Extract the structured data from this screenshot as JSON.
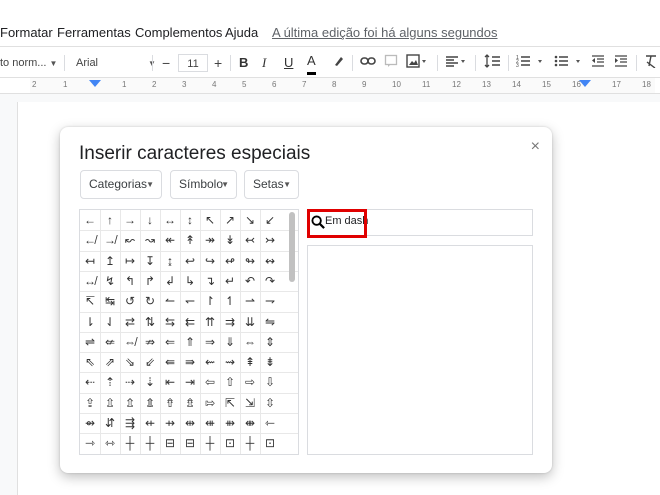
{
  "menu": {
    "items": [
      "Formatar",
      "Ferramentas",
      "Complementos",
      "Ajuda"
    ],
    "last_edit": "A última edição foi há alguns segundos"
  },
  "toolbar": {
    "style": "to norm...",
    "font": "Arial",
    "minus": "−",
    "font_size": "11",
    "plus": "+",
    "bold": "B",
    "italic": "I",
    "underline": "U",
    "text_color": "A"
  },
  "ruler": {
    "numbers": [
      "2",
      "1",
      "1",
      "2",
      "3",
      "4",
      "5",
      "6",
      "7",
      "8",
      "9",
      "10",
      "11",
      "12",
      "13",
      "14",
      "15",
      "16",
      "17",
      "18"
    ]
  },
  "dialog": {
    "title": "Inserir caracteres especiais",
    "close": "×",
    "dropdowns": [
      "Categorias",
      "Símbolo",
      "Setas"
    ],
    "search_value": "Em dash",
    "search_highlight_color": "#e00000"
  },
  "grid_symbols": [
    [
      "←",
      "↑",
      "→",
      "↓",
      "↔",
      "↕",
      "↖",
      "↗",
      "↘",
      "↙"
    ],
    [
      "↚",
      "↛",
      "↜",
      "↝",
      "↞",
      "↟",
      "↠",
      "↡",
      "↢",
      "↣"
    ],
    [
      "↤",
      "↥",
      "↦",
      "↧",
      "↨",
      "↩",
      "↪",
      "↫",
      "↬",
      "↭"
    ],
    [
      "↮",
      "↯",
      "↰",
      "↱",
      "↲",
      "↳",
      "↴",
      "↵",
      "↶",
      "↷"
    ],
    [
      "↸",
      "↹",
      "↺",
      "↻",
      "↼",
      "↽",
      "↾",
      "↿",
      "⇀",
      "⇁"
    ],
    [
      "⇂",
      "⇃",
      "⇄",
      "⇅",
      "⇆",
      "⇇",
      "⇈",
      "⇉",
      "⇊",
      "⇋"
    ],
    [
      "⇌",
      "⇍",
      "⇎",
      "⇏",
      "⇐",
      "⇑",
      "⇒",
      "⇓",
      "⇔",
      "⇕"
    ],
    [
      "⇖",
      "⇗",
      "⇘",
      "⇙",
      "⇚",
      "⇛",
      "⇜",
      "⇝",
      "⇞",
      "⇟"
    ],
    [
      "⇠",
      "⇡",
      "⇢",
      "⇣",
      "⇤",
      "⇥",
      "⇦",
      "⇧",
      "⇨",
      "⇩"
    ],
    [
      "⇪",
      "⇫",
      "⇬",
      "⇭",
      "⇮",
      "⇯",
      "⇰",
      "⇱",
      "⇲",
      "⇳"
    ],
    [
      "⇴",
      "⇵",
      "⇶",
      "⇷",
      "⇸",
      "⇹",
      "⇺",
      "⇻",
      "⇼",
      "⇽"
    ],
    [
      "⇾",
      "⇿",
      "┼",
      "┼",
      "⊟",
      "⊟",
      "┼",
      "⊡",
      "┼",
      "⊡"
    ]
  ]
}
